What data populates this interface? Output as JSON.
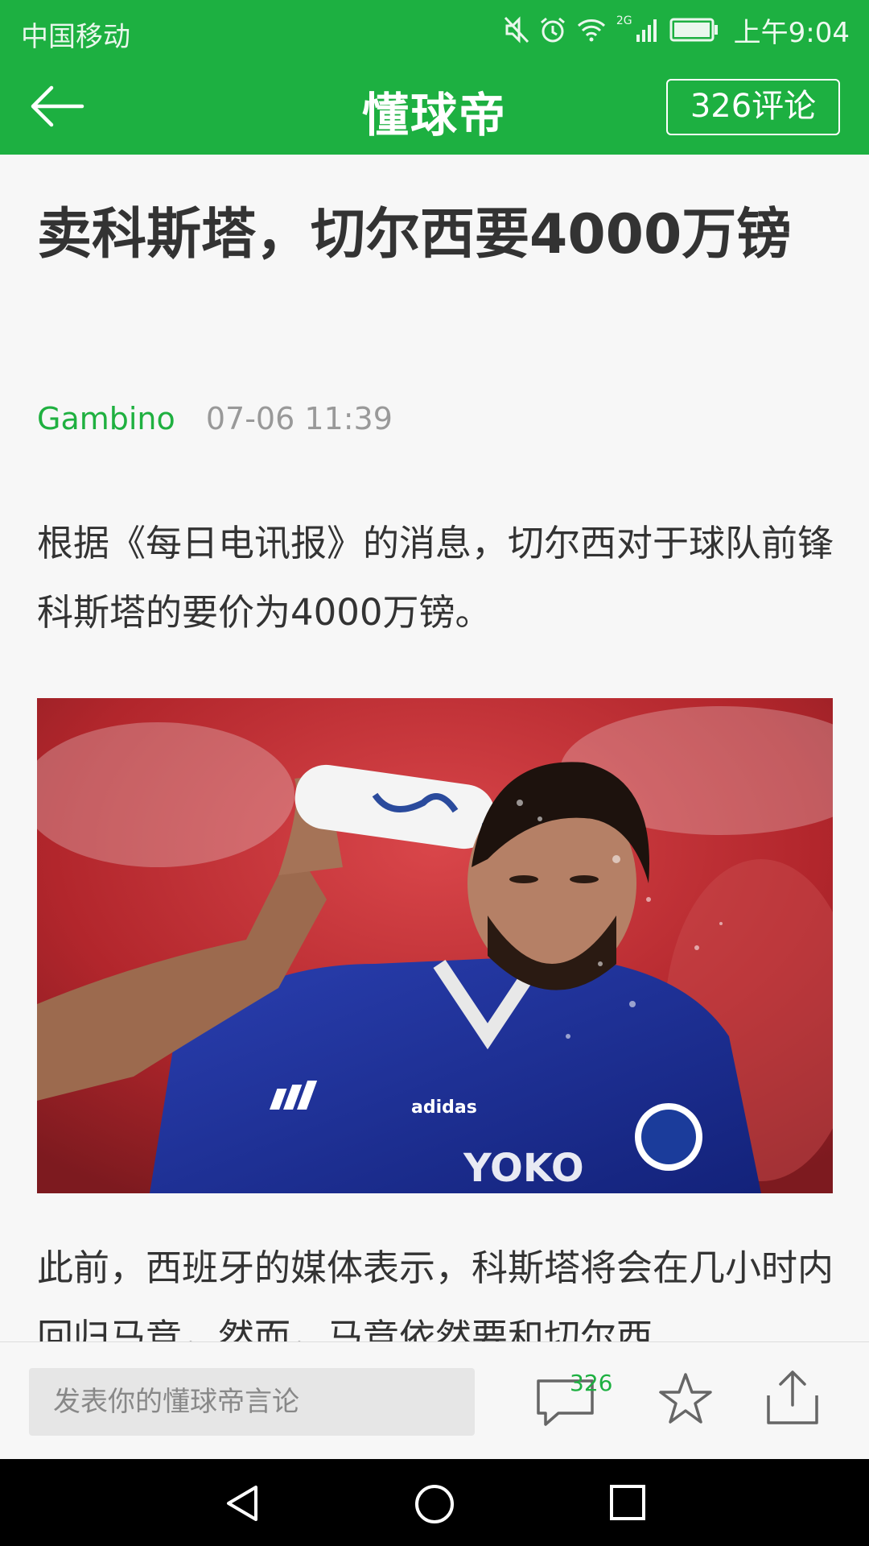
{
  "status_bar": {
    "carrier": "中国移动",
    "network": "2G",
    "time": "上午9:04"
  },
  "header": {
    "logo": "懂球帝",
    "comments_button": "326评论"
  },
  "article": {
    "title": "卖科斯塔，切尔西要4000万镑",
    "author": "Gambino",
    "date": "07-06 11:39",
    "paragraphs": [
      "根据《每日电讯报》的消息，切尔西对于球队前锋科斯塔的要价为4000万镑。",
      "此前，西班牙的媒体表示，科斯塔将会在几小时内回归马竞，然而，马竞依然要和切尔西"
    ]
  },
  "bottom_bar": {
    "comment_placeholder": "发表你的懂球帝言论",
    "comment_count": "326"
  },
  "colors": {
    "brand": "#1db041",
    "author": "#1fb040"
  },
  "icons": [
    "mute-icon",
    "alarm-icon",
    "wifi-icon",
    "signal-icon",
    "battery-icon",
    "back-arrow-icon",
    "comment-icon",
    "star-icon",
    "share-icon",
    "nav-back-icon",
    "nav-home-icon",
    "nav-recents-icon"
  ]
}
